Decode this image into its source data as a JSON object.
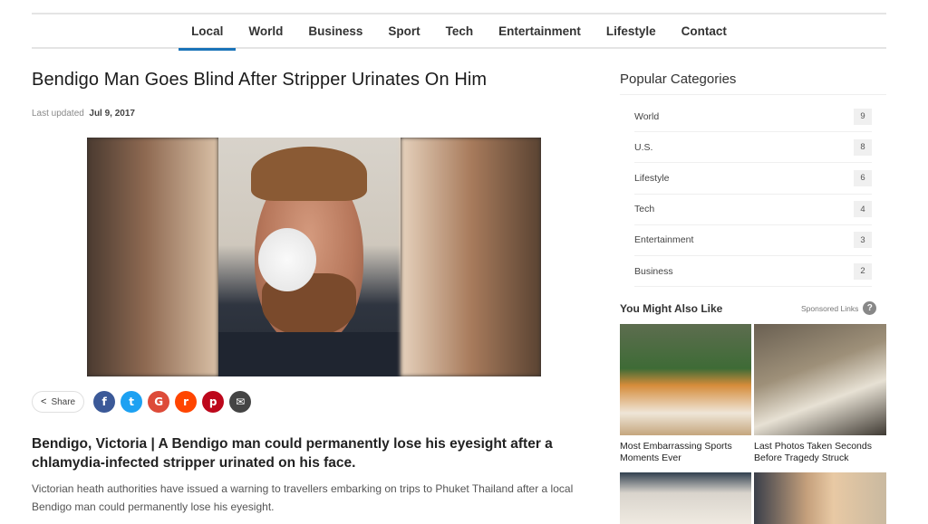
{
  "nav": {
    "items": [
      "Local",
      "World",
      "Business",
      "Sport",
      "Tech",
      "Entertainment",
      "Lifestyle",
      "Contact"
    ],
    "active": "Local"
  },
  "article": {
    "title": "Bendigo Man Goes Blind After Stripper Urinates On Him",
    "meta_label": "Last updated",
    "meta_date": "Jul 9, 2017",
    "lead": "Bendigo, Victoria | A Bendigo man could permanently lose his eyesight after a chlamydia-infected stripper urinated on his face.",
    "body": "Victorian heath authorities have issued a warning to travellers embarking on trips to Phuket Thailand after a local Bendigo man could permanently lose his eyesight."
  },
  "share": {
    "label": "Share",
    "buttons": [
      {
        "name": "facebook",
        "glyph": "f",
        "color": "#3b5998"
      },
      {
        "name": "twitter",
        "glyph": "t",
        "color": "#1da1f2"
      },
      {
        "name": "google",
        "glyph": "G",
        "color": "#dd4b39"
      },
      {
        "name": "reddit",
        "glyph": "r",
        "color": "#ff4500"
      },
      {
        "name": "pinterest",
        "glyph": "p",
        "color": "#bd081c"
      },
      {
        "name": "email",
        "glyph": "✉",
        "color": "#444444"
      }
    ]
  },
  "sidebar": {
    "title": "Popular Categories",
    "categories": [
      {
        "label": "World",
        "count": "9"
      },
      {
        "label": "U.S.",
        "count": "8"
      },
      {
        "label": "Lifestyle",
        "count": "6"
      },
      {
        "label": "Tech",
        "count": "4"
      },
      {
        "label": "Entertainment",
        "count": "3"
      },
      {
        "label": "Business",
        "count": "2"
      }
    ]
  },
  "recommend": {
    "title": "You Might Also Like",
    "sponsored": "Sponsored Links",
    "items": [
      {
        "caption": "Most Embarrassing Sports Moments Ever"
      },
      {
        "caption": "Last Photos Taken Seconds Before Tragedy Struck"
      }
    ]
  },
  "colors": {
    "accent": "#1a73b8"
  }
}
